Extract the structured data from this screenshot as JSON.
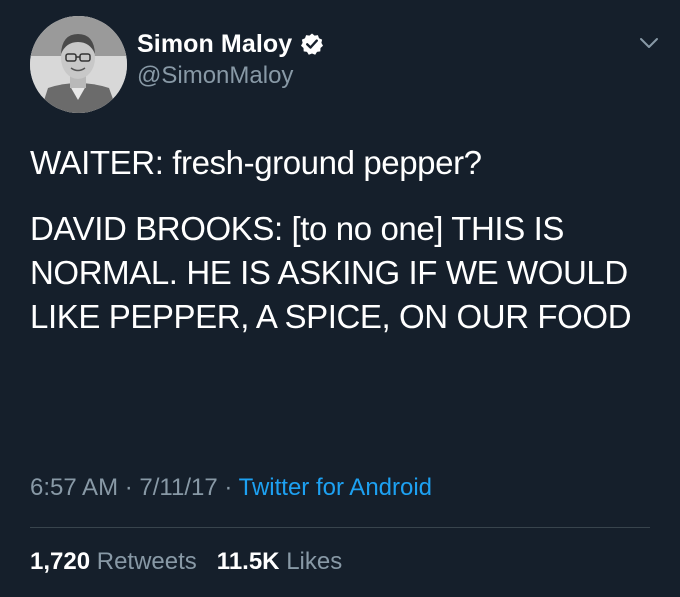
{
  "author": {
    "display_name": "Simon Maloy",
    "handle": "@SimonMaloy",
    "verified_icon": "verified-badge-icon",
    "avatar_icon": "profile-photo"
  },
  "tweet": {
    "paragraphs": [
      "WAITER: fresh-ground pepper?",
      "DAVID BROOKS: [to no one] THIS IS NORMAL. HE IS ASKING IF WE WOULD LIKE PEPPER, A SPICE, ON OUR FOOD"
    ]
  },
  "meta": {
    "time": "6:57 AM",
    "separator": "·",
    "date": "7/11/17",
    "source": "Twitter for Android"
  },
  "stats": {
    "retweets_count": "1,720",
    "retweets_label": "Retweets",
    "likes_count": "11.5K",
    "likes_label": "Likes"
  },
  "colors": {
    "background": "#151f2b",
    "text": "#ffffff",
    "secondary": "#8899a6",
    "link": "#1da1f2",
    "divider": "#38444d"
  }
}
